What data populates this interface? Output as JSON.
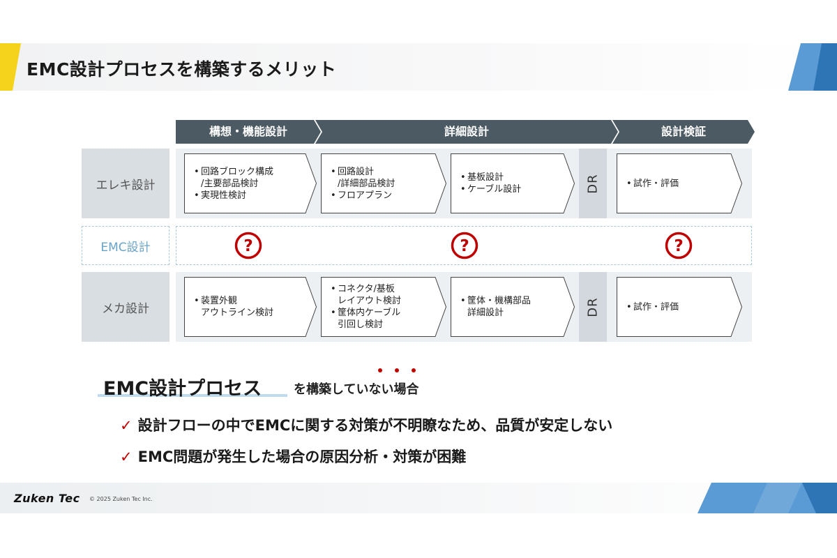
{
  "title": "EMC設計プロセスを構築するメリット",
  "phases": [
    "構想・機能設計",
    "詳細設計",
    "設計検証"
  ],
  "rows": {
    "elec": {
      "label": "エレキ設計",
      "boxes": [
        {
          "items": [
            [
              "回路ブロック構成",
              "/主要部品検討"
            ],
            [
              "実現性検討"
            ]
          ]
        },
        {
          "items": [
            [
              "回路設計",
              "/詳細部品検討"
            ],
            [
              "フロアプラン"
            ]
          ]
        },
        {
          "items": [
            [
              "基板設計"
            ],
            [
              "ケーブル設計"
            ]
          ]
        },
        {
          "items": [
            [
              "試作・評価"
            ]
          ]
        }
      ],
      "dr": "DR"
    },
    "emc": {
      "label": "EMC設計"
    },
    "mech": {
      "label": "メカ設計",
      "boxes": [
        {
          "items": [
            [
              "装置外観",
              "アウトライン検討"
            ]
          ]
        },
        {
          "items": [
            [
              "コネクタ/基板",
              "レイアウト検討"
            ],
            [
              "筐体内ケーブル",
              "引回し検討"
            ]
          ]
        },
        {
          "items": [
            [
              "筐体・機構部品",
              "詳細設計"
            ]
          ]
        },
        {
          "items": [
            [
              "試作・評価"
            ]
          ]
        }
      ],
      "dr": "DR"
    }
  },
  "subtitle": {
    "main": "EMC設計プロセス",
    "rest": "を構築していない場合"
  },
  "bullets": [
    "設計フローの中でEMCに関する対策が不明瞭なため、品質が安定しない",
    "EMC問題が発生した場合の原因分析・対策が困難"
  ],
  "footer": {
    "logo": "Zuken Tec",
    "copyright": "© 2025 Zuken Tec Inc."
  },
  "colors": {
    "phase": "#4b5a63",
    "accent_red": "#c00000",
    "emc_blue": "#6aa3c8",
    "row_label": "#d9dee2"
  }
}
